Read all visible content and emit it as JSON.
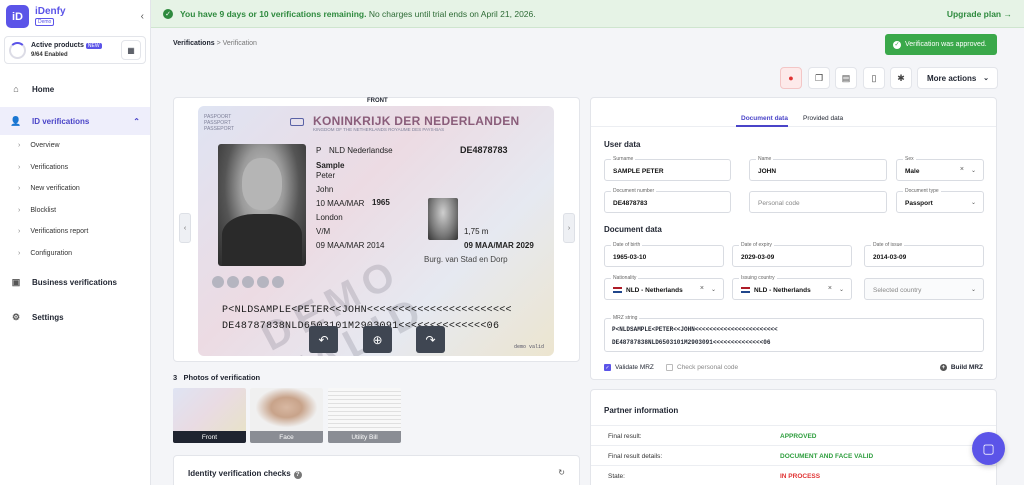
{
  "app": {
    "logo_letters": "iD",
    "name": "iDenfy",
    "env_badge": "Demo"
  },
  "products": {
    "title": "Active products",
    "badge": "NEW",
    "subtitle": "9/64 Enabled",
    "progress": 0.14
  },
  "nav": {
    "home": "Home",
    "id_verifications": "ID verifications",
    "sub_items": [
      "Overview",
      "Verifications",
      "New verification",
      "Blocklist",
      "Verifications report",
      "Configuration"
    ],
    "business": "Business verifications",
    "settings": "Settings"
  },
  "banner": {
    "strong": "You have 9 days or 10 verifications remaining.",
    "rest": " No charges until trial ends on April 21, 2026.",
    "upgrade": "Upgrade plan →"
  },
  "breadcrumb": {
    "parent": "Verifications",
    "separator": ">",
    "current": "Verification"
  },
  "toast": "Verification was approved.",
  "actions": {
    "more_actions": "More actions"
  },
  "document_image": {
    "side_label": "FRONT",
    "header_left": [
      "PASPOORT",
      "PASSPORT",
      "PASSEPORT"
    ],
    "country": "KONINKRIJK DER NEDERLANDEN",
    "country_sub": "KINGDOM OF THE NETHERLANDS   ROYAUME DES PAYS-BAS",
    "doc_type": "P",
    "issuer": "NLD Nederlandse",
    "doc_number": "DE4878783",
    "surname": "Sample",
    "surname2": "Peter",
    "given_name": "John",
    "dob": "10 MAA/MAR",
    "dob_year": "1965",
    "place": "London",
    "sex": "V/M",
    "height": "1,75 m",
    "issue_date": "09 MAA/MAR 2014",
    "expiry_date": "09 MAA/MAR 2029",
    "authority": "Burg. van Stad en Dorp",
    "watermark": "DEMO VALID",
    "mrz_line1": "P<NLDSAMPLE<PETER<<JOHN<<<<<<<<<<<<<<<<<<<<<<<",
    "mrz_line2": "DE48787838NLD6503101M2903091<<<<<<<<<<<<<<06",
    "demo_label": "demo valid"
  },
  "photos": {
    "count": "3",
    "title": "Photos of verification",
    "items": [
      "Front",
      "Face",
      "Utility Bill"
    ]
  },
  "checks": {
    "title": "Identity verification checks"
  },
  "tabs": [
    "Document data",
    "Provided data"
  ],
  "user_data": {
    "title": "User data",
    "surname_label": "Surname",
    "surname": "SAMPLE PETER",
    "name_label": "Name",
    "name": "JOHN",
    "sex_label": "Sex",
    "sex": "Male",
    "docnum_label": "Document number",
    "docnum": "DE4878783",
    "personal_code_placeholder": "Personal code",
    "doctype_label": "Document type",
    "doctype": "Passport"
  },
  "document_data": {
    "title": "Document data",
    "dob_label": "Date of birth",
    "dob": "1965-03-10",
    "expiry_label": "Date of expiry",
    "expiry": "2029-03-09",
    "issue_label": "Date of issue",
    "issue": "2014-03-09",
    "nationality_label": "Nationality",
    "nationality": "NLD - Netherlands",
    "issuing_label": "Issuing country",
    "issuing": "NLD - Netherlands",
    "selected_country_placeholder": "Selected country",
    "mrz_label": "MRZ string",
    "mrz_line1": "P<NLDSAMPLE<PETER<<JOHN<<<<<<<<<<<<<<<<<<<<<<<",
    "mrz_line2": "DE48787838NLD6503101M2903091<<<<<<<<<<<<<<06",
    "validate_mrz": "Validate MRZ",
    "check_personal_code": "Check personal code",
    "build_mrz": "Build MRZ"
  },
  "partner": {
    "title": "Partner information",
    "rows": [
      {
        "key": "Final result:",
        "value": "APPROVED",
        "color": "#2e9e3e"
      },
      {
        "key": "Final result details:",
        "value": "DOCUMENT AND FACE VALID",
        "color": "#2e9e3e"
      },
      {
        "key": "State:",
        "value": "IN PROCESS",
        "color": "#e03333"
      }
    ]
  },
  "colors": {
    "accent": "#5b54e8",
    "success": "#3aa84a",
    "danger": "#e03333"
  }
}
